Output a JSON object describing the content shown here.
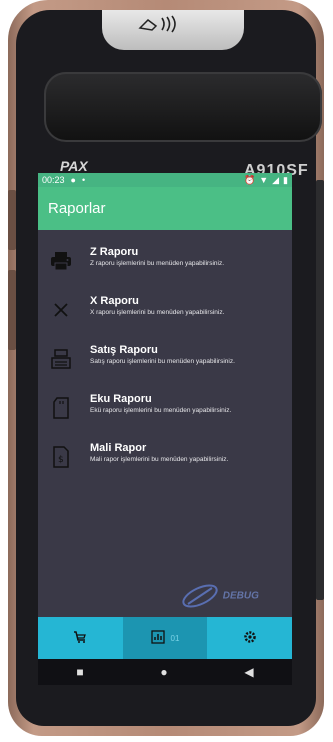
{
  "device": {
    "brand": "PAX",
    "model": "A910SF"
  },
  "statusbar": {
    "time": "00:23",
    "icons_left": [
      "app-icon",
      "notification-dot"
    ],
    "icons_right": [
      "alarm-icon",
      "wifi-icon",
      "signal-icon",
      "battery-icon"
    ]
  },
  "appbar": {
    "title": "Raporlar"
  },
  "menu": {
    "items": [
      {
        "icon": "printer-icon",
        "title": "Z Raporu",
        "subtitle": "Z raporu işlemlerini bu menüden yapabilirsiniz."
      },
      {
        "icon": "close-icon",
        "title": "X Raporu",
        "subtitle": "X raporu işlemlerini bu menüden yapabilirsiniz."
      },
      {
        "icon": "cash-register-icon",
        "title": "Satış Raporu",
        "subtitle": "Satış raporu işlemlerini bu menüden yapabilirsiniz."
      },
      {
        "icon": "sd-card-icon",
        "title": "Eku Raporu",
        "subtitle": "Ekü raporu işlemlerini bu menüden yapabilirsiniz."
      },
      {
        "icon": "invoice-icon",
        "title": "Mali Rapor",
        "subtitle": "Mali rapor işlemlerini bu menüden yapabilirsiniz."
      }
    ]
  },
  "watermark": {
    "text": "DEBUG"
  },
  "bottom_nav": {
    "tabs": [
      {
        "icon": "cart-icon",
        "label": ""
      },
      {
        "icon": "chart-icon",
        "label": "01"
      },
      {
        "icon": "settings-icon",
        "label": ""
      }
    ]
  },
  "system_nav": [
    "recent-apps-icon",
    "home-icon",
    "back-icon"
  ]
}
